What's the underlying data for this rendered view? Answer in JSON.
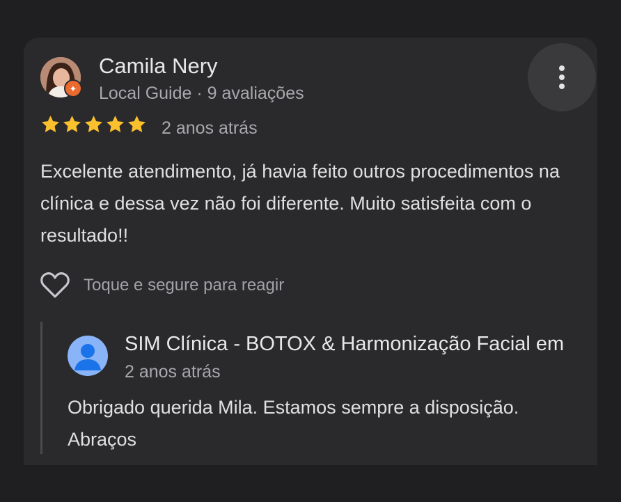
{
  "review": {
    "author_name": "Camila Nery",
    "author_meta": "Local Guide · 9 avaliações",
    "badge_icon": "local-guide-star",
    "rating": 5,
    "rating_max": 5,
    "star_color": "#fbc02d",
    "date": "2 anos atrás",
    "text": "Excelente atendimento, já havia feito outros procedimentos na clínica e dessa vez não foi diferente. Muito satisfeita com o resultado!!",
    "react_label": "Toque e segure para reagir",
    "more_icon": "more-vertical-icon"
  },
  "owner_reply": {
    "name": "SIM Clínica - BOTOX & Harmonização Facial em",
    "date": "2 anos atrás",
    "text": "Obrigado querida Mila. Estamos sempre a disposição. Abraços",
    "avatar_icon": "default-person-avatar"
  },
  "colors": {
    "background": "#1f1f21",
    "card": "#2a2a2c",
    "accent_badge": "#ea6a2f",
    "avatar_blue": "#8ab4f8"
  }
}
